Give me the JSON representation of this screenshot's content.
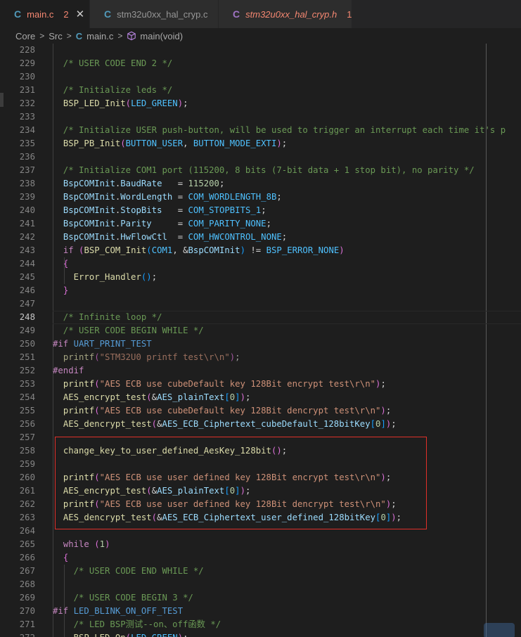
{
  "tabs": [
    {
      "icon": "C",
      "name": "main.c",
      "badge": "2",
      "close": "✕",
      "active": true,
      "color": "#f48771",
      "icon_color": "#519aba"
    },
    {
      "icon": "C",
      "name": "stm32u0xx_hal_cryp.c",
      "active": false,
      "color": "#969696",
      "icon_color": "#519aba"
    },
    {
      "icon": "C",
      "name": "stm32u0xx_hal_cryp.h",
      "badge": "1",
      "active": false,
      "color": "#f48771",
      "icon_color": "#a074c4"
    }
  ],
  "breadcrumb": {
    "parts": [
      "Core",
      "Src"
    ],
    "file_icon": "C",
    "file": "main.c",
    "symbol": "main(void)",
    "separator": ">"
  },
  "current_line": 248,
  "lines": [
    {
      "n": 228,
      "tokens": []
    },
    {
      "n": 229,
      "tokens": [
        [
          "com",
          "  /* USER CODE END 2 */"
        ]
      ]
    },
    {
      "n": 230,
      "tokens": []
    },
    {
      "n": 231,
      "tokens": [
        [
          "com",
          "  /* Initialize leds */"
        ]
      ]
    },
    {
      "n": 232,
      "tokens": [
        [
          "txt",
          "  "
        ],
        [
          "fn",
          "BSP_LED_Init"
        ],
        [
          "br1",
          "("
        ],
        [
          "mac",
          "LED_GREEN"
        ],
        [
          "br1",
          ")"
        ],
        [
          "txt",
          ";"
        ]
      ]
    },
    {
      "n": 233,
      "tokens": []
    },
    {
      "n": 234,
      "tokens": [
        [
          "com",
          "  /* Initialize USER push-button, will be used to trigger an interrupt each time it's p"
        ]
      ]
    },
    {
      "n": 235,
      "tokens": [
        [
          "txt",
          "  "
        ],
        [
          "fn",
          "BSP_PB_Init"
        ],
        [
          "br1",
          "("
        ],
        [
          "mac",
          "BUTTON_USER"
        ],
        [
          "txt",
          ", "
        ],
        [
          "mac",
          "BUTTON_MODE_EXTI"
        ],
        [
          "br1",
          ")"
        ],
        [
          "txt",
          ";"
        ]
      ]
    },
    {
      "n": 236,
      "tokens": []
    },
    {
      "n": 237,
      "tokens": [
        [
          "com",
          "  /* Initialize COM1 port (115200, 8 bits (7-bit data + 1 stop bit), no parity */"
        ]
      ]
    },
    {
      "n": 238,
      "tokens": [
        [
          "txt",
          "  "
        ],
        [
          "var",
          "BspCOMInit"
        ],
        [
          "txt",
          "."
        ],
        [
          "var",
          "BaudRate"
        ],
        [
          "txt",
          "   = "
        ],
        [
          "num",
          "115200"
        ],
        [
          "txt",
          ";"
        ]
      ]
    },
    {
      "n": 239,
      "tokens": [
        [
          "txt",
          "  "
        ],
        [
          "var",
          "BspCOMInit"
        ],
        [
          "txt",
          "."
        ],
        [
          "var",
          "WordLength"
        ],
        [
          "txt",
          " = "
        ],
        [
          "mac",
          "COM_WORDLENGTH_8B"
        ],
        [
          "txt",
          ";"
        ]
      ]
    },
    {
      "n": 240,
      "tokens": [
        [
          "txt",
          "  "
        ],
        [
          "var",
          "BspCOMInit"
        ],
        [
          "txt",
          "."
        ],
        [
          "var",
          "StopBits"
        ],
        [
          "txt",
          "   = "
        ],
        [
          "mac",
          "COM_STOPBITS_1"
        ],
        [
          "txt",
          ";"
        ]
      ]
    },
    {
      "n": 241,
      "tokens": [
        [
          "txt",
          "  "
        ],
        [
          "var",
          "BspCOMInit"
        ],
        [
          "txt",
          "."
        ],
        [
          "var",
          "Parity"
        ],
        [
          "txt",
          "     = "
        ],
        [
          "mac",
          "COM_PARITY_NONE"
        ],
        [
          "txt",
          ";"
        ]
      ]
    },
    {
      "n": 242,
      "tokens": [
        [
          "txt",
          "  "
        ],
        [
          "var",
          "BspCOMInit"
        ],
        [
          "txt",
          "."
        ],
        [
          "var",
          "HwFlowCtl"
        ],
        [
          "txt",
          "  = "
        ],
        [
          "mac",
          "COM_HWCONTROL_NONE"
        ],
        [
          "txt",
          ";"
        ]
      ]
    },
    {
      "n": 243,
      "tokens": [
        [
          "txt",
          "  "
        ],
        [
          "kw",
          "if"
        ],
        [
          "txt",
          " "
        ],
        [
          "br1",
          "("
        ],
        [
          "fn",
          "BSP_COM_Init"
        ],
        [
          "br2",
          "("
        ],
        [
          "mac",
          "COM1"
        ],
        [
          "txt",
          ", &"
        ],
        [
          "var",
          "BspCOMInit"
        ],
        [
          "br2",
          ")"
        ],
        [
          "txt",
          " != "
        ],
        [
          "mac",
          "BSP_ERROR_NONE"
        ],
        [
          "br1",
          ")"
        ]
      ]
    },
    {
      "n": 244,
      "tokens": [
        [
          "txt",
          "  "
        ],
        [
          "br1",
          "{"
        ]
      ]
    },
    {
      "n": 245,
      "tokens": [
        [
          "txt",
          "    "
        ],
        [
          "fn",
          "Error_Handler"
        ],
        [
          "br2",
          "()"
        ],
        [
          "txt",
          ";"
        ]
      ]
    },
    {
      "n": 246,
      "tokens": [
        [
          "txt",
          "  "
        ],
        [
          "br1",
          "}"
        ]
      ]
    },
    {
      "n": 247,
      "tokens": []
    },
    {
      "n": 248,
      "tokens": [
        [
          "com",
          "  /* Infinite loop */"
        ]
      ]
    },
    {
      "n": 249,
      "tokens": [
        [
          "com",
          "  /* USER CODE BEGIN WHILE */"
        ]
      ]
    },
    {
      "n": 250,
      "tokens": [
        [
          "dir",
          "#if"
        ],
        [
          "txt",
          " "
        ],
        [
          "def",
          "UART_PRINT_TEST"
        ]
      ]
    },
    {
      "n": 251,
      "tokens": [
        [
          "txt",
          "  "
        ],
        [
          "fn",
          "printf"
        ],
        [
          "br1",
          "("
        ],
        [
          "str",
          "\"STM32U0 printf test\\r\\n\""
        ],
        [
          "br1",
          ")"
        ],
        [
          "txt",
          ";"
        ]
      ],
      "dim": true
    },
    {
      "n": 252,
      "tokens": [
        [
          "dir",
          "#endif"
        ]
      ]
    },
    {
      "n": 253,
      "tokens": [
        [
          "txt",
          "  "
        ],
        [
          "fn",
          "printf"
        ],
        [
          "br1",
          "("
        ],
        [
          "str",
          "\"AES ECB use cubeDefault key 128Bit encrypt test\\r\\n\""
        ],
        [
          "br1",
          ")"
        ],
        [
          "txt",
          ";"
        ]
      ]
    },
    {
      "n": 254,
      "tokens": [
        [
          "txt",
          "  "
        ],
        [
          "fn",
          "AES_encrypt_test"
        ],
        [
          "br1",
          "("
        ],
        [
          "txt",
          "&"
        ],
        [
          "var",
          "AES_plainText"
        ],
        [
          "br2",
          "["
        ],
        [
          "num",
          "0"
        ],
        [
          "br2",
          "]"
        ],
        [
          "br1",
          ")"
        ],
        [
          "txt",
          ";"
        ]
      ]
    },
    {
      "n": 255,
      "tokens": [
        [
          "txt",
          "  "
        ],
        [
          "fn",
          "printf"
        ],
        [
          "br1",
          "("
        ],
        [
          "str",
          "\"AES ECB use cubeDefault key 128Bit dencrypt test\\r\\n\""
        ],
        [
          "br1",
          ")"
        ],
        [
          "txt",
          ";"
        ]
      ]
    },
    {
      "n": 256,
      "tokens": [
        [
          "txt",
          "  "
        ],
        [
          "fn",
          "AES_dencrypt_test"
        ],
        [
          "br1",
          "("
        ],
        [
          "txt",
          "&"
        ],
        [
          "var",
          "AES_ECB_Ciphertext_cubeDefault_128bitKey"
        ],
        [
          "br2",
          "["
        ],
        [
          "num",
          "0"
        ],
        [
          "br2",
          "]"
        ],
        [
          "br1",
          ")"
        ],
        [
          "txt",
          ";"
        ]
      ]
    },
    {
      "n": 257,
      "tokens": []
    },
    {
      "n": 258,
      "tokens": [
        [
          "txt",
          "  "
        ],
        [
          "fn",
          "change_key_to_user_defined_AesKey_128bit"
        ],
        [
          "br1",
          "()"
        ],
        [
          "txt",
          ";"
        ]
      ]
    },
    {
      "n": 259,
      "tokens": []
    },
    {
      "n": 260,
      "tokens": [
        [
          "txt",
          "  "
        ],
        [
          "fn",
          "printf"
        ],
        [
          "br1",
          "("
        ],
        [
          "str",
          "\"AES ECB use user defined key 128Bit encrypt test\\r\\n\""
        ],
        [
          "br1",
          ")"
        ],
        [
          "txt",
          ";"
        ]
      ]
    },
    {
      "n": 261,
      "tokens": [
        [
          "txt",
          "  "
        ],
        [
          "fn",
          "AES_encrypt_test"
        ],
        [
          "br1",
          "("
        ],
        [
          "txt",
          "&"
        ],
        [
          "var",
          "AES_plainText"
        ],
        [
          "br2",
          "["
        ],
        [
          "num",
          "0"
        ],
        [
          "br2",
          "]"
        ],
        [
          "br1",
          ")"
        ],
        [
          "txt",
          ";"
        ]
      ]
    },
    {
      "n": 262,
      "tokens": [
        [
          "txt",
          "  "
        ],
        [
          "fn",
          "printf"
        ],
        [
          "br1",
          "("
        ],
        [
          "str",
          "\"AES ECB use user defined key 128Bit dencrypt test\\r\\n\""
        ],
        [
          "br1",
          ")"
        ],
        [
          "txt",
          ";"
        ]
      ]
    },
    {
      "n": 263,
      "tokens": [
        [
          "txt",
          "  "
        ],
        [
          "fn",
          "AES_dencrypt_test"
        ],
        [
          "br1",
          "("
        ],
        [
          "txt",
          "&"
        ],
        [
          "var",
          "AES_ECB_Ciphertext_user_defined_128bitKey"
        ],
        [
          "br2",
          "["
        ],
        [
          "num",
          "0"
        ],
        [
          "br2",
          "]"
        ],
        [
          "br1",
          ")"
        ],
        [
          "txt",
          ";"
        ]
      ]
    },
    {
      "n": 264,
      "tokens": []
    },
    {
      "n": 265,
      "tokens": [
        [
          "txt",
          "  "
        ],
        [
          "kw",
          "while"
        ],
        [
          "txt",
          " "
        ],
        [
          "br1",
          "("
        ],
        [
          "num",
          "1"
        ],
        [
          "br1",
          ")"
        ]
      ]
    },
    {
      "n": 266,
      "tokens": [
        [
          "txt",
          "  "
        ],
        [
          "br1",
          "{"
        ]
      ]
    },
    {
      "n": 267,
      "tokens": [
        [
          "com",
          "    /* USER CODE END WHILE */"
        ]
      ]
    },
    {
      "n": 268,
      "tokens": []
    },
    {
      "n": 269,
      "tokens": [
        [
          "com",
          "    /* USER CODE BEGIN 3 */"
        ]
      ]
    },
    {
      "n": 270,
      "tokens": [
        [
          "dir",
          "#if"
        ],
        [
          "txt",
          " "
        ],
        [
          "def",
          "LED_BLINK_ON_OFF_TEST"
        ]
      ]
    },
    {
      "n": 271,
      "tokens": [
        [
          "com",
          "    /* LED BSP测试--on、off函数 */"
        ]
      ]
    },
    {
      "n": 272,
      "tokens": [
        [
          "txt",
          "    "
        ],
        [
          "fn",
          "BSP_LED_On"
        ],
        [
          "br1",
          "("
        ],
        [
          "mac",
          "LED_GREEN"
        ],
        [
          "br1",
          ")"
        ],
        [
          "txt",
          ";"
        ]
      ]
    }
  ],
  "colors": {
    "background": "#1e1e1e",
    "highlight_border": "#e0302a"
  }
}
